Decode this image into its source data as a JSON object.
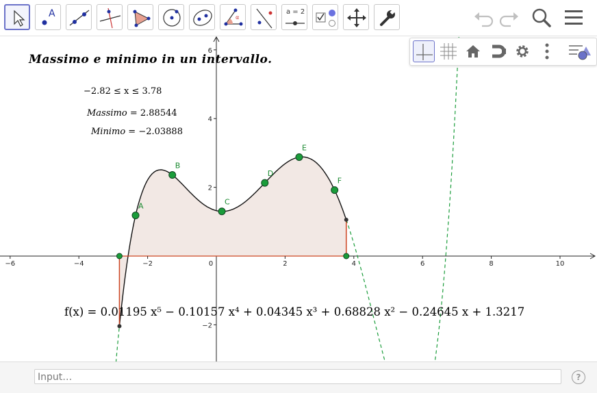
{
  "toolbar": {
    "tools": [
      {
        "name": "move-tool",
        "label": ""
      },
      {
        "name": "point-tool",
        "label": "A"
      },
      {
        "name": "line-tool",
        "label": ""
      },
      {
        "name": "perpendicular-line-tool",
        "label": ""
      },
      {
        "name": "polygon-tool",
        "label": ""
      },
      {
        "name": "circle-tool",
        "label": ""
      },
      {
        "name": "ellipse-tool",
        "label": ""
      },
      {
        "name": "angle-tool",
        "label": "α"
      },
      {
        "name": "reflect-tool",
        "label": ""
      },
      {
        "name": "slider-tool",
        "label": "a = 2"
      },
      {
        "name": "checkbox-tool",
        "label": ""
      },
      {
        "name": "move-graphics-view-tool",
        "label": ""
      },
      {
        "name": "settings-tool",
        "label": ""
      }
    ]
  },
  "graphics": {
    "title": "Massimo e minimo in un intervallo.",
    "interval_text": "−2.82 ≤  x  ≤ 3.78",
    "max_label": "Massimo",
    "max_value": "= 2.88544",
    "min_label": "Minimo",
    "min_value": "= −2.03888",
    "function_text": "f(x) = 0.01195 x⁵ − 0.10157 x⁴ + 0.04345 x³ + 0.68828 x² − 0.24645 x + 1.3217",
    "x_ticks": [
      "−6",
      "−4",
      "−2",
      "0",
      "2",
      "4",
      "6",
      "8",
      "10"
    ],
    "y_ticks": [
      "6",
      "4",
      "2",
      "−2"
    ],
    "points": [
      "A",
      "B",
      "C",
      "D",
      "E",
      "F"
    ]
  },
  "input_bar": {
    "placeholder": "Input…",
    "help": "?"
  },
  "colors": {
    "accent": "#6b72c9",
    "point_green": "#1a9c3a",
    "label_green": "#1a8a30",
    "area_fill": "#f2e8e4",
    "segment_red": "#cc4422"
  }
}
